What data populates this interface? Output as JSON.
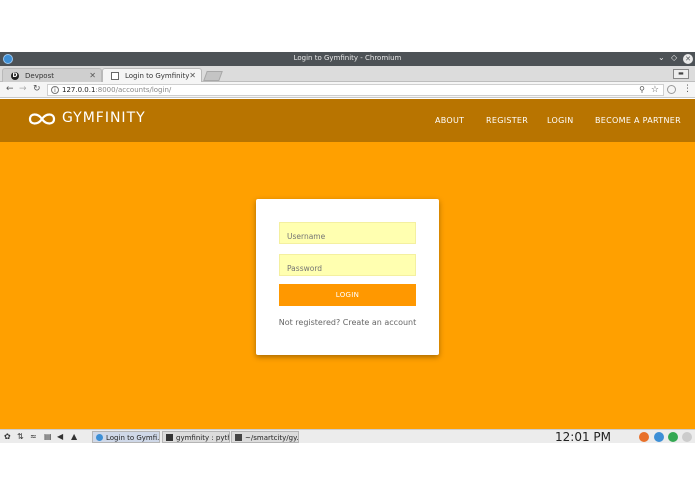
{
  "window": {
    "title": "Login to Gymfinity - Chromium"
  },
  "tabs": [
    {
      "label": "Devpost",
      "icon": "devpost-d-icon"
    },
    {
      "label": "Login to Gymfinity",
      "icon": "page-icon"
    }
  ],
  "address_bar": {
    "url_host": "127.0.0.1",
    "url_rest": ":8000/accounts/login/"
  },
  "site": {
    "brand": "GYMFINITY",
    "nav": [
      "ABOUT",
      "REGISTER",
      "LOGIN",
      "BECOME A PARTNER"
    ]
  },
  "login_form": {
    "username_placeholder": "Username",
    "password_placeholder": "Password",
    "submit_label": "LOGIN",
    "register_text": "Not registered? Create an account"
  },
  "taskbar": {
    "tasks": [
      {
        "label": "Login to Gymfi..."
      },
      {
        "label": "gymfinity : pyth..."
      },
      {
        "label": "~/smartcity/gy..."
      }
    ],
    "clock": "12:01 PM"
  },
  "colors": {
    "header": "#b87400",
    "page_bg": "#ffa000",
    "button": "#ff9800",
    "field_bg": "#ffffb0"
  }
}
